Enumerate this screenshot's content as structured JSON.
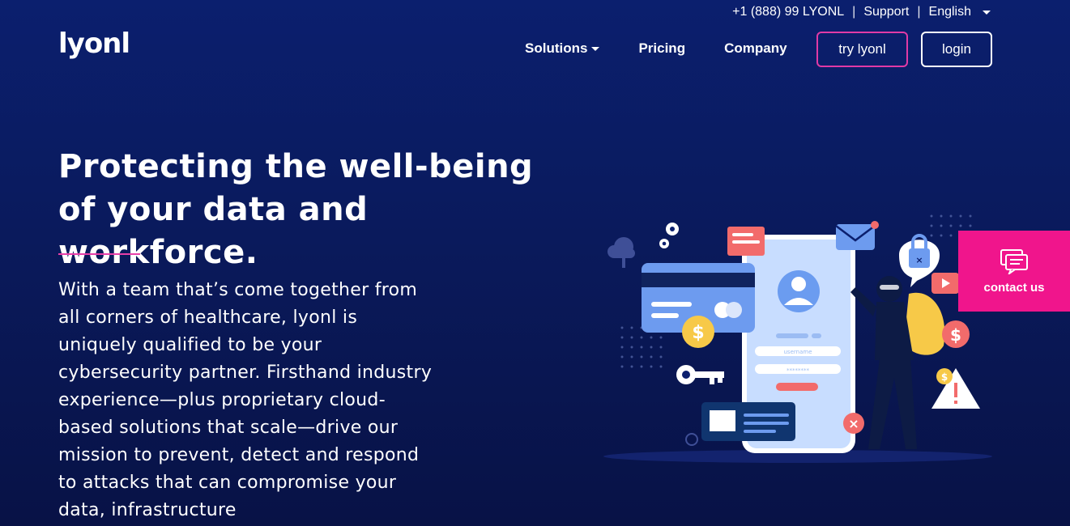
{
  "topbar": {
    "phone": "+1 (888) 99 LYONL",
    "support": "Support",
    "language": "English",
    "separator": "|"
  },
  "header": {
    "logo": "lyonl",
    "nav": [
      "Solutions",
      "Pricing",
      "Company"
    ],
    "try_button": "try lyonl",
    "login_button": "login"
  },
  "hero": {
    "title_line1": "Protecting the well-being",
    "title_line2": "of your data and workforce.",
    "body": "With a team that’s come together from all corners of healthcare, lyonl is uniquely qualified to be your cybersecurity partner. Firsthand industry experience—plus proprietary cloud-based solutions that scale—drive our mission to prevent, detect and respond to attacks that can compromise your data, infrastructure"
  },
  "illustration": {
    "username_label": "username",
    "password_mask": "********"
  },
  "contact": {
    "label": "contact us"
  },
  "colors": {
    "accent_pink": "#f0158c",
    "background": "#0b1f6e"
  }
}
